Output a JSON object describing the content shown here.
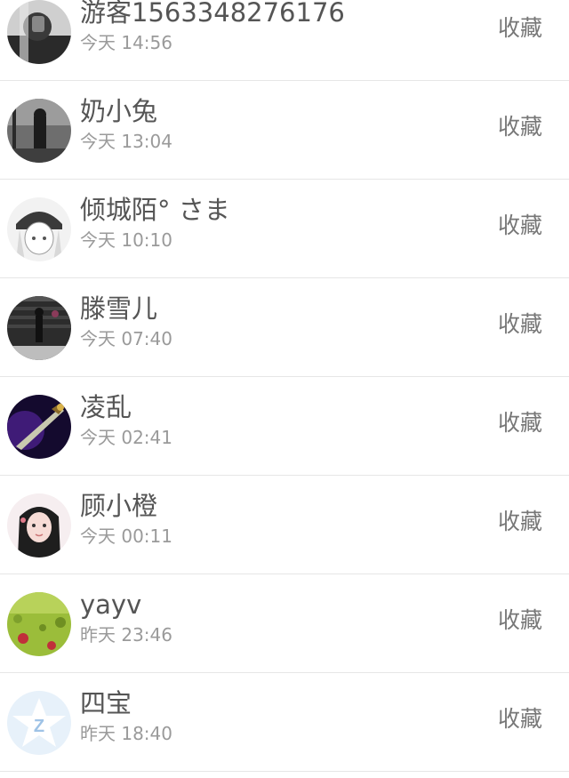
{
  "favorite_label": "收藏",
  "users": [
    {
      "name": "游客1563348276176",
      "time": "今天 14:56",
      "avatar_icon": "avatar-photo-dark"
    },
    {
      "name": "奶小兔",
      "time": "今天 13:04",
      "avatar_icon": "avatar-photo-bw"
    },
    {
      "name": "倾城陌° さま",
      "time": "今天 10:10",
      "avatar_icon": "avatar-anime"
    },
    {
      "name": "滕雪儿",
      "time": "今天 07:40",
      "avatar_icon": "avatar-photo-dark"
    },
    {
      "name": "凌乱",
      "time": "今天 02:41",
      "avatar_icon": "avatar-sword"
    },
    {
      "name": "顾小橙",
      "time": "今天 00:11",
      "avatar_icon": "avatar-girl"
    },
    {
      "name": "yayv",
      "time": "昨天 23:46",
      "avatar_icon": "avatar-grass"
    },
    {
      "name": "四宝",
      "time": "昨天 18:40",
      "avatar_icon": "avatar-qzone-default"
    }
  ]
}
